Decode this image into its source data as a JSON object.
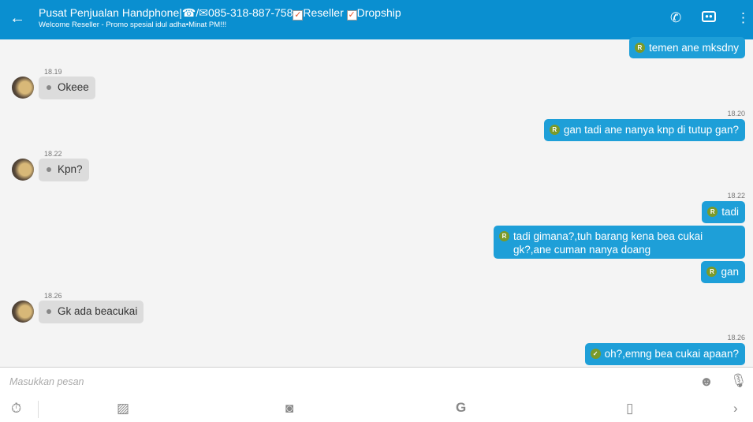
{
  "header": {
    "title_name": "Pusat Penjualan Handphone|☎/✉085-318-887-758",
    "check1": "✓",
    "reseller": "Reseller",
    "check2": "✓",
    "dropship": "Dropship",
    "subtitle": "Welcome Reseller - Promo spesial idul adha•Minat PM!!!"
  },
  "messages": [
    {
      "dir": "out",
      "text": "temen ane mksdny",
      "badge": "R"
    },
    {
      "dir": "in",
      "time": "18.19",
      "text": "Okeee"
    },
    {
      "dir": "out",
      "time": "18.20",
      "text": "gan tadi ane nanya knp di tutup gan?",
      "badge": "R"
    },
    {
      "dir": "in",
      "time": "18.22",
      "text": "Kpn?"
    },
    {
      "dir": "out",
      "time": "18.22",
      "text": "tadi",
      "badge": "R"
    },
    {
      "dir": "out",
      "text": "tadi gimana?,tuh barang kena bea cukai gk?,ane cuman nanya doang",
      "badge": "R"
    },
    {
      "dir": "out",
      "text": "gan",
      "badge": "R"
    },
    {
      "dir": "in",
      "time": "18.26",
      "text": "Gk ada beacukai"
    },
    {
      "dir": "out",
      "time": "18.26",
      "text": "oh?,emng bea cukai apaan?",
      "badge": "✓"
    }
  ],
  "input": {
    "placeholder": "Masukkan pesan"
  },
  "colors": {
    "header": "#0a8fd0",
    "outgoing": "#1e9fd8",
    "incoming": "#dcdcdc",
    "badge": "#7a9a2a"
  }
}
